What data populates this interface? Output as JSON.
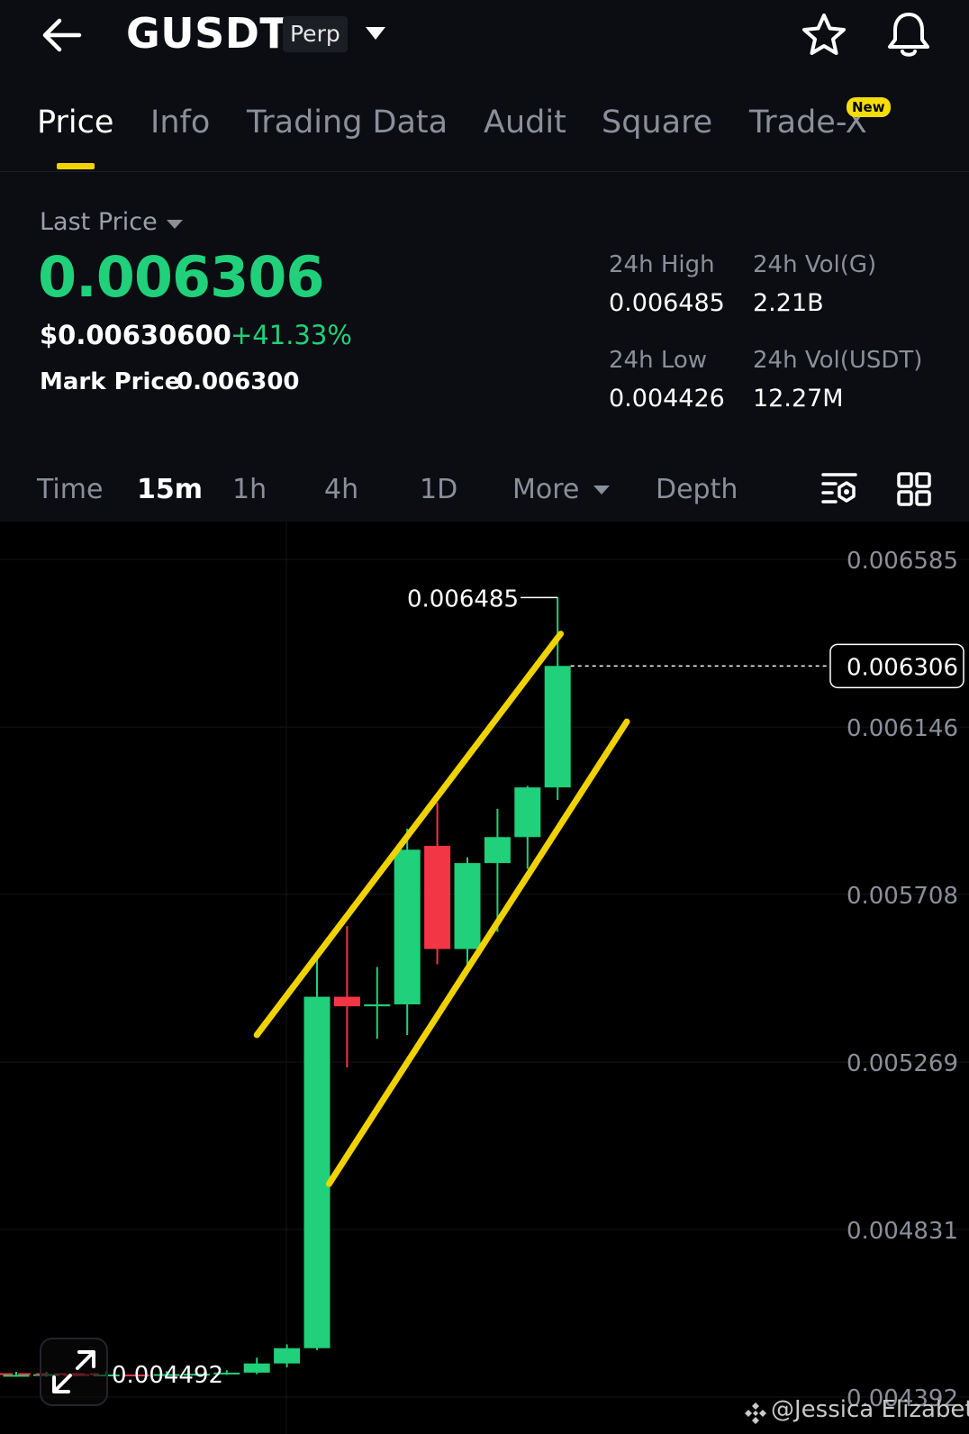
{
  "header": {
    "symbol": "GUSDT",
    "contract_type": "Perp"
  },
  "tabs": [
    {
      "label": "Price",
      "active": true
    },
    {
      "label": "Info"
    },
    {
      "label": "Trading Data"
    },
    {
      "label": "Audit"
    },
    {
      "label": "Square"
    },
    {
      "label": "Trade-X",
      "badge": "New"
    }
  ],
  "ticker": {
    "last_price_label": "Last Price",
    "last_price": "0.006306",
    "usd_price": "$0.00630600",
    "change_pct": "+41.33%",
    "mark_price_label": "Mark Price",
    "mark_price": "0.006300",
    "high_label": "24h High",
    "high": "0.006485",
    "low_label": "24h Low",
    "low": "0.004426",
    "vol_base_label": "24h Vol(G)",
    "vol_base": "2.21B",
    "vol_quote_label": "24h Vol(USDT)",
    "vol_quote": "12.27M"
  },
  "timeframes": {
    "items": [
      "Time",
      "15m",
      "1h",
      "4h",
      "1D"
    ],
    "active": "15m",
    "more_label": "More",
    "depth_label": "Depth"
  },
  "colors": {
    "up": "#20d07a",
    "down": "#f23645",
    "accent": "#f0d200",
    "background": "#000000",
    "panel": "#0c0d12"
  },
  "chart_data": {
    "type": "candlestick",
    "interval": "15m",
    "y_ticks": [
      "0.006585",
      "0.006146",
      "0.005708",
      "0.005269",
      "0.004831",
      "0.004392"
    ],
    "ylim": [
      0.004392,
      0.006585
    ],
    "last_price_tag": "0.006306",
    "max_label": "0.006485",
    "min_label": "0.004492",
    "candles": [
      {
        "o": 0.00445,
        "h": 0.004458,
        "l": 0.004445,
        "c": 0.00445
      },
      {
        "o": 0.00445,
        "h": 0.004458,
        "l": 0.004445,
        "c": 0.004452
      },
      {
        "o": 0.004452,
        "h": 0.004456,
        "l": 0.004446,
        "c": 0.00445
      },
      {
        "o": 0.00445,
        "h": 0.00446,
        "l": 0.004446,
        "c": 0.004451
      },
      {
        "o": 0.004451,
        "h": 0.004458,
        "l": 0.004446,
        "c": 0.00445
      },
      {
        "o": 0.00445,
        "h": 0.00446,
        "l": 0.004446,
        "c": 0.004452
      },
      {
        "o": 0.004452,
        "h": 0.004458,
        "l": 0.004448,
        "c": 0.004453
      },
      {
        "o": 0.004453,
        "h": 0.004462,
        "l": 0.00445,
        "c": 0.004456
      },
      {
        "o": 0.004456,
        "h": 0.004495,
        "l": 0.004452,
        "c": 0.00448
      },
      {
        "o": 0.00448,
        "h": 0.00453,
        "l": 0.00447,
        "c": 0.00452
      },
      {
        "o": 0.00452,
        "h": 0.00555,
        "l": 0.004515,
        "c": 0.00544
      },
      {
        "o": 0.00544,
        "h": 0.005625,
        "l": 0.005255,
        "c": 0.005415
      },
      {
        "o": 0.005415,
        "h": 0.005518,
        "l": 0.00533,
        "c": 0.00542
      },
      {
        "o": 0.00542,
        "h": 0.00588,
        "l": 0.00534,
        "c": 0.005825
      },
      {
        "o": 0.005835,
        "h": 0.005948,
        "l": 0.005525,
        "c": 0.005565
      },
      {
        "o": 0.005565,
        "h": 0.005805,
        "l": 0.005515,
        "c": 0.00579
      },
      {
        "o": 0.00579,
        "h": 0.005932,
        "l": 0.00561,
        "c": 0.005858
      },
      {
        "o": 0.005858,
        "h": 0.005992,
        "l": 0.005775,
        "c": 0.005988
      },
      {
        "o": 0.005988,
        "h": 0.006485,
        "l": 0.005955,
        "c": 0.006306
      }
    ],
    "channel_lines": [
      {
        "from": {
          "candle": 8.0,
          "price": 0.00534
        },
        "to": {
          "candle": 18.1,
          "price": 0.00639
        }
      },
      {
        "from": {
          "candle": 10.4,
          "price": 0.00495
        },
        "to": {
          "candle": 20.3,
          "price": 0.00616
        }
      }
    ]
  },
  "watermark": "@Jessica Elizabeth"
}
